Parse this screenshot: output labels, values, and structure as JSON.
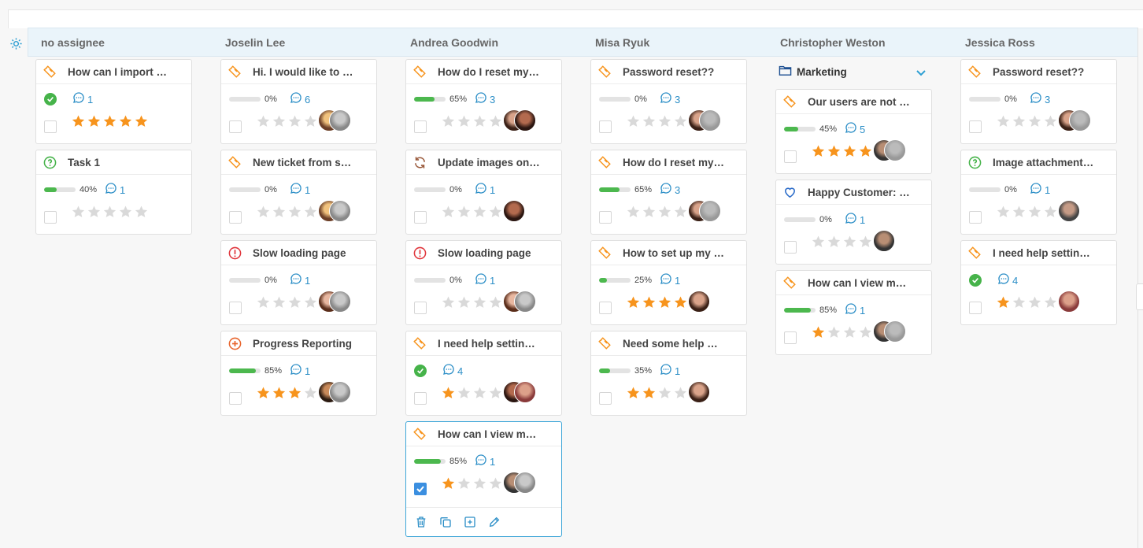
{
  "colors": {
    "accent": "#2d8fc7",
    "header_bg": "#eaf4fa",
    "progress": "#4cb84e",
    "star": "#f7941d",
    "star_empty": "#d9d9d9"
  },
  "columns": [
    {
      "name": "no assignee",
      "cards": [
        {
          "title": "How can I import …",
          "icon": "ticket-icon",
          "done": true,
          "comments": "1",
          "rating": 5,
          "avatars": []
        },
        {
          "title": "Task 1",
          "icon": "question-icon",
          "progress": "40%",
          "progress_value": 0.4,
          "comments": "1",
          "rating": 0,
          "avatars": []
        }
      ]
    },
    {
      "name": "Joselin Lee",
      "cards": [
        {
          "title": "Hi. I would like to r…",
          "icon": "ticket-icon",
          "progress": "0%",
          "progress_value": 0,
          "comments": "6",
          "rating": 0,
          "avatars": [
            "f1",
            "f2"
          ]
        },
        {
          "title": "New ticket from s…",
          "icon": "ticket-icon",
          "progress": "0%",
          "progress_value": 0,
          "comments": "1",
          "rating": 0,
          "avatars": [
            "f1",
            "f2"
          ]
        },
        {
          "title": "Slow loading page",
          "icon": "alert-icon",
          "progress": "0%",
          "progress_value": 0,
          "comments": "1",
          "rating": 0,
          "avatars": [
            "f3",
            "f2"
          ]
        },
        {
          "title": "Progress Reporting",
          "icon": "plus-circle-icon",
          "progress": "85%",
          "progress_value": 0.85,
          "comments": "1",
          "rating": 3,
          "avatars": [
            "m1",
            "f2"
          ]
        }
      ]
    },
    {
      "name": "Andrea Goodwin",
      "cards": [
        {
          "title": "How do I reset my …",
          "icon": "ticket-icon",
          "progress": "65%",
          "progress_value": 0.65,
          "comments": "3",
          "rating": 0,
          "avatars": [
            "f4",
            "f5"
          ]
        },
        {
          "title": "Update images on …",
          "icon": "refresh-icon",
          "progress": "0%",
          "progress_value": 0,
          "comments": "1",
          "rating": 0,
          "avatars": [
            "f5"
          ]
        },
        {
          "title": "Slow loading page",
          "icon": "alert-icon",
          "progress": "0%",
          "progress_value": 0,
          "comments": "1",
          "rating": 0,
          "avatars": [
            "f3",
            "f2"
          ]
        },
        {
          "title": "I need help setting…",
          "icon": "ticket-icon",
          "done": true,
          "comments": "4",
          "rating": 1,
          "avatars": [
            "f5",
            "f6"
          ]
        },
        {
          "title": "How can I view my…",
          "icon": "ticket-icon",
          "progress": "85%",
          "progress_value": 0.85,
          "comments": "1",
          "rating": 1,
          "avatars": [
            "m2",
            "f2"
          ],
          "selected": true
        }
      ]
    },
    {
      "name": "Misa Ryuk",
      "cards": [
        {
          "title": "Password reset??",
          "icon": "ticket-icon",
          "progress": "0%",
          "progress_value": 0,
          "comments": "3",
          "rating": 0,
          "avatars": [
            "f4",
            "f7"
          ]
        },
        {
          "title": "How do I reset my …",
          "icon": "ticket-icon",
          "progress": "65%",
          "progress_value": 0.65,
          "comments": "3",
          "rating": 0,
          "avatars": [
            "f4",
            "f7"
          ]
        },
        {
          "title": "How to set up my …",
          "icon": "ticket-icon",
          "progress": "25%",
          "progress_value": 0.25,
          "comments": "1",
          "rating": 4,
          "avatars": [
            "f4"
          ]
        },
        {
          "title": "Need some help w…",
          "icon": "ticket-icon",
          "progress": "35%",
          "progress_value": 0.35,
          "comments": "1",
          "rating": 2,
          "avatars": [
            "f4"
          ]
        }
      ]
    },
    {
      "name": "Christopher Weston",
      "group": "Marketing",
      "cards": [
        {
          "title": "Our users are not …",
          "icon": "ticket-icon",
          "progress": "45%",
          "progress_value": 0.45,
          "comments": "5",
          "rating": 5,
          "avatars": [
            "m2",
            "f7"
          ]
        },
        {
          "title": "Happy Customer: …",
          "icon": "heart-icon",
          "progress": "0%",
          "progress_value": 0,
          "comments": "1",
          "rating": 0,
          "avatars": [
            "m2"
          ]
        },
        {
          "title": "How can I view my…",
          "icon": "ticket-icon",
          "progress": "85%",
          "progress_value": 0.85,
          "comments": "1",
          "rating": 1,
          "avatars": [
            "m2",
            "f7"
          ]
        }
      ]
    },
    {
      "name": "Jessica Ross",
      "cards": [
        {
          "title": "Password reset??",
          "icon": "ticket-icon",
          "progress": "0%",
          "progress_value": 0,
          "comments": "3",
          "rating": 0,
          "avatars": [
            "f4",
            "f7"
          ]
        },
        {
          "title": "Image attachment…",
          "icon": "question-icon",
          "progress": "0%",
          "progress_value": 0,
          "comments": "1",
          "rating": 0,
          "avatars": [
            "f8"
          ]
        },
        {
          "title": "I need help setting…",
          "icon": "ticket-icon",
          "done": true,
          "comments": "4",
          "rating": 1,
          "avatars": [
            "f6"
          ]
        }
      ]
    }
  ],
  "selected_actions": [
    "trash-icon",
    "duplicate-icon",
    "add-subtask-icon",
    "edit-icon"
  ]
}
